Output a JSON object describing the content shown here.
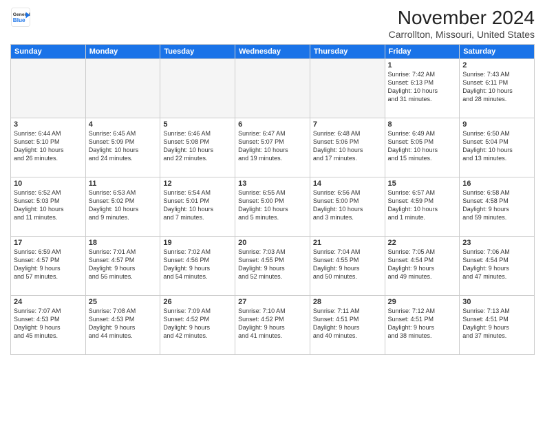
{
  "header": {
    "logo_line1": "General",
    "logo_line2": "Blue",
    "month_title": "November 2024",
    "location": "Carrollton, Missouri, United States"
  },
  "weekdays": [
    "Sunday",
    "Monday",
    "Tuesday",
    "Wednesday",
    "Thursday",
    "Friday",
    "Saturday"
  ],
  "weeks": [
    [
      {
        "day": "",
        "detail": ""
      },
      {
        "day": "",
        "detail": ""
      },
      {
        "day": "",
        "detail": ""
      },
      {
        "day": "",
        "detail": ""
      },
      {
        "day": "",
        "detail": ""
      },
      {
        "day": "1",
        "detail": "Sunrise: 7:42 AM\nSunset: 6:13 PM\nDaylight: 10 hours\nand 31 minutes."
      },
      {
        "day": "2",
        "detail": "Sunrise: 7:43 AM\nSunset: 6:11 PM\nDaylight: 10 hours\nand 28 minutes."
      }
    ],
    [
      {
        "day": "3",
        "detail": "Sunrise: 6:44 AM\nSunset: 5:10 PM\nDaylight: 10 hours\nand 26 minutes."
      },
      {
        "day": "4",
        "detail": "Sunrise: 6:45 AM\nSunset: 5:09 PM\nDaylight: 10 hours\nand 24 minutes."
      },
      {
        "day": "5",
        "detail": "Sunrise: 6:46 AM\nSunset: 5:08 PM\nDaylight: 10 hours\nand 22 minutes."
      },
      {
        "day": "6",
        "detail": "Sunrise: 6:47 AM\nSunset: 5:07 PM\nDaylight: 10 hours\nand 19 minutes."
      },
      {
        "day": "7",
        "detail": "Sunrise: 6:48 AM\nSunset: 5:06 PM\nDaylight: 10 hours\nand 17 minutes."
      },
      {
        "day": "8",
        "detail": "Sunrise: 6:49 AM\nSunset: 5:05 PM\nDaylight: 10 hours\nand 15 minutes."
      },
      {
        "day": "9",
        "detail": "Sunrise: 6:50 AM\nSunset: 5:04 PM\nDaylight: 10 hours\nand 13 minutes."
      }
    ],
    [
      {
        "day": "10",
        "detail": "Sunrise: 6:52 AM\nSunset: 5:03 PM\nDaylight: 10 hours\nand 11 minutes."
      },
      {
        "day": "11",
        "detail": "Sunrise: 6:53 AM\nSunset: 5:02 PM\nDaylight: 10 hours\nand 9 minutes."
      },
      {
        "day": "12",
        "detail": "Sunrise: 6:54 AM\nSunset: 5:01 PM\nDaylight: 10 hours\nand 7 minutes."
      },
      {
        "day": "13",
        "detail": "Sunrise: 6:55 AM\nSunset: 5:00 PM\nDaylight: 10 hours\nand 5 minutes."
      },
      {
        "day": "14",
        "detail": "Sunrise: 6:56 AM\nSunset: 5:00 PM\nDaylight: 10 hours\nand 3 minutes."
      },
      {
        "day": "15",
        "detail": "Sunrise: 6:57 AM\nSunset: 4:59 PM\nDaylight: 10 hours\nand 1 minute."
      },
      {
        "day": "16",
        "detail": "Sunrise: 6:58 AM\nSunset: 4:58 PM\nDaylight: 9 hours\nand 59 minutes."
      }
    ],
    [
      {
        "day": "17",
        "detail": "Sunrise: 6:59 AM\nSunset: 4:57 PM\nDaylight: 9 hours\nand 57 minutes."
      },
      {
        "day": "18",
        "detail": "Sunrise: 7:01 AM\nSunset: 4:57 PM\nDaylight: 9 hours\nand 56 minutes."
      },
      {
        "day": "19",
        "detail": "Sunrise: 7:02 AM\nSunset: 4:56 PM\nDaylight: 9 hours\nand 54 minutes."
      },
      {
        "day": "20",
        "detail": "Sunrise: 7:03 AM\nSunset: 4:55 PM\nDaylight: 9 hours\nand 52 minutes."
      },
      {
        "day": "21",
        "detail": "Sunrise: 7:04 AM\nSunset: 4:55 PM\nDaylight: 9 hours\nand 50 minutes."
      },
      {
        "day": "22",
        "detail": "Sunrise: 7:05 AM\nSunset: 4:54 PM\nDaylight: 9 hours\nand 49 minutes."
      },
      {
        "day": "23",
        "detail": "Sunrise: 7:06 AM\nSunset: 4:54 PM\nDaylight: 9 hours\nand 47 minutes."
      }
    ],
    [
      {
        "day": "24",
        "detail": "Sunrise: 7:07 AM\nSunset: 4:53 PM\nDaylight: 9 hours\nand 45 minutes."
      },
      {
        "day": "25",
        "detail": "Sunrise: 7:08 AM\nSunset: 4:53 PM\nDaylight: 9 hours\nand 44 minutes."
      },
      {
        "day": "26",
        "detail": "Sunrise: 7:09 AM\nSunset: 4:52 PM\nDaylight: 9 hours\nand 42 minutes."
      },
      {
        "day": "27",
        "detail": "Sunrise: 7:10 AM\nSunset: 4:52 PM\nDaylight: 9 hours\nand 41 minutes."
      },
      {
        "day": "28",
        "detail": "Sunrise: 7:11 AM\nSunset: 4:51 PM\nDaylight: 9 hours\nand 40 minutes."
      },
      {
        "day": "29",
        "detail": "Sunrise: 7:12 AM\nSunset: 4:51 PM\nDaylight: 9 hours\nand 38 minutes."
      },
      {
        "day": "30",
        "detail": "Sunrise: 7:13 AM\nSunset: 4:51 PM\nDaylight: 9 hours\nand 37 minutes."
      }
    ]
  ]
}
